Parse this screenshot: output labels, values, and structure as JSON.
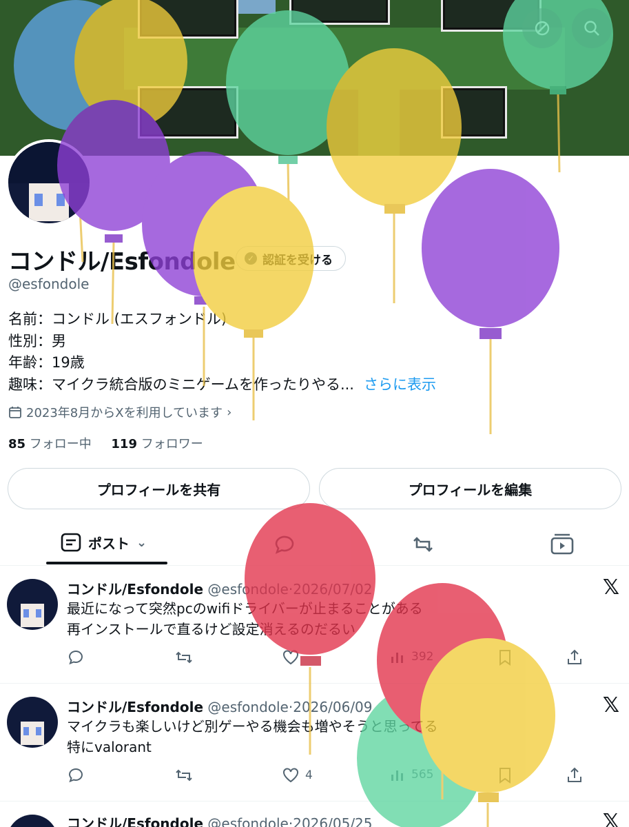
{
  "profile": {
    "name": "コンドル/Esfondole",
    "verify_label": "認証を受ける",
    "handle": "@esfondole",
    "bio": [
      "名前：コンドル (エスフォンドル)",
      "性別：男",
      "年齢：19歳",
      "趣味：マイクラ統合版のミニゲームを作ったりやる..."
    ],
    "bio_more": "さらに表示",
    "joined": "2023年8月からXを利用しています",
    "following_count": "85",
    "following_label": "フォロー中",
    "followers_count": "119",
    "followers_label": "フォロワー"
  },
  "buttons": {
    "share": "プロフィールを共有",
    "edit": "プロフィールを編集"
  },
  "tabs": {
    "posts": "ポスト"
  },
  "tweets": [
    {
      "name": "コンドル/Esfondole",
      "handle": "@esfondole",
      "date": "2026/07/02",
      "lines": [
        "最近になって突然pcのwifiドライバーが止まることがある",
        "再インストールで直るけど設定消えるのだるい"
      ],
      "likes": "",
      "views": "392"
    },
    {
      "name": "コンドル/Esfondole",
      "handle": "@esfondole",
      "date": "2026/06/09",
      "lines": [
        "マイクラも楽しいけど別ゲーやる機会も増やそうと思ってる",
        "特にvalorant"
      ],
      "likes": "4",
      "views": "565"
    },
    {
      "name": "コンドル/Esfondole",
      "handle": "@esfondole",
      "date": "2026/05/25",
      "lines": [],
      "likes": "",
      "views": ""
    }
  ],
  "icons": {
    "x_logo": "𝕏",
    "separator": "·"
  },
  "colors": {
    "link": "#1d9bf0",
    "muted": "#536471",
    "text": "#0f1419"
  }
}
